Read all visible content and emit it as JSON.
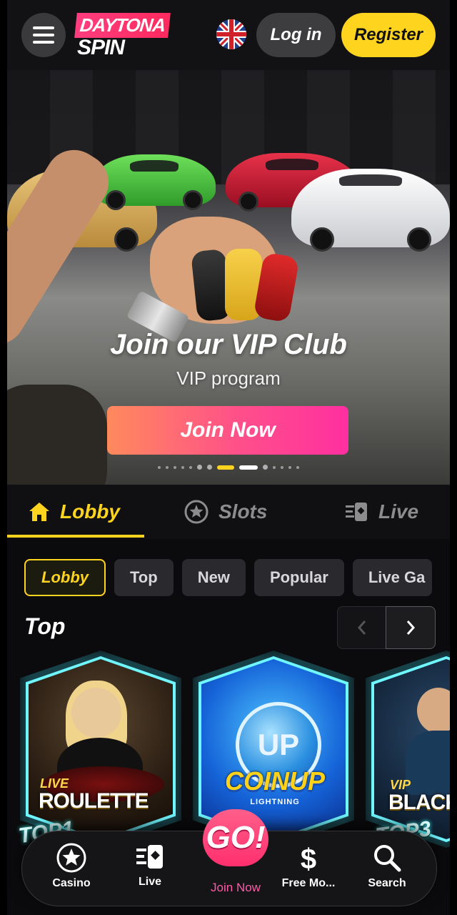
{
  "header": {
    "logo_top": "DAYTONA",
    "logo_bottom": "SPIN",
    "login_label": "Log in",
    "register_label": "Register"
  },
  "hero": {
    "title": "Join our VIP Club",
    "subtitle": "VIP program",
    "cta_label": "Join Now",
    "slides_total": 14,
    "active_slide": 8
  },
  "main_tabs": [
    {
      "label": "Lobby",
      "icon": "home-icon",
      "active": true
    },
    {
      "label": "Slots",
      "icon": "star-icon",
      "active": false
    },
    {
      "label": "Live",
      "icon": "live-cards-icon",
      "active": false
    }
  ],
  "chips": [
    {
      "label": "Lobby",
      "active": true
    },
    {
      "label": "Top",
      "active": false
    },
    {
      "label": "New",
      "active": false
    },
    {
      "label": "Popular",
      "active": false
    },
    {
      "label": "Live Ga",
      "active": false
    }
  ],
  "section": {
    "title": "Top"
  },
  "games": [
    {
      "small": "LIVE",
      "large": "ROULETTE",
      "badge": "TOP1"
    },
    {
      "coin": "UP",
      "title": "COINUP",
      "sub": "LIGHTNING"
    },
    {
      "small": "VIP",
      "large": "BLACK",
      "badge": "TOP3"
    }
  ],
  "bottom_nav": {
    "casino": "Casino",
    "live": "Live",
    "go": "GO!",
    "join": "Join Now",
    "free_money": "Free Mo...",
    "search": "Search"
  },
  "colors": {
    "accent": "#ffd41f",
    "cta_gradient_start": "#ff8a5c",
    "cta_gradient_end": "#ff2fa0",
    "card_glow": "#6ff6ff"
  }
}
